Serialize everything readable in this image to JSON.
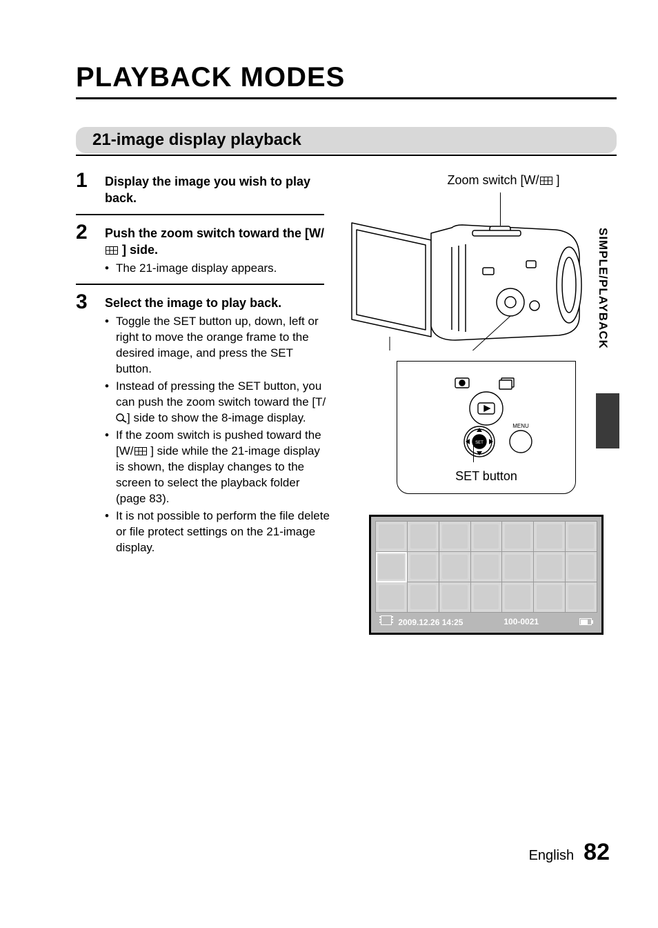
{
  "title": "PLAYBACK MODES",
  "subheading": "21-image display playback",
  "sidebar_label": "SIMPLE/PLAYBACK",
  "zoom_switch_label_pre": "Zoom switch [W/",
  "zoom_switch_label_post": " ]",
  "set_button_label": "SET button",
  "steps": {
    "s1": {
      "num": "1",
      "head": "Display the image you wish to play back."
    },
    "s2": {
      "num": "2",
      "head_pre": "Push the zoom switch toward the [W/",
      "head_post": " ] side.",
      "b1": "The 21-image display appears."
    },
    "s3": {
      "num": "3",
      "head": "Select the image to play back.",
      "b1": "Toggle the SET button up, down, left or right to move the orange frame to the desired image, and press the SET button.",
      "b2_pre": "Instead of pressing the SET button, you can push the zoom switch toward the [T/",
      "b2_post": "] side to show the 8-image display.",
      "b3_pre": "If the zoom switch is pushed toward the [W/",
      "b3_post": " ] side while the 21-image display is shown, the display changes to the screen to select the playback folder (page 83).",
      "b4": "It is not possible to perform the file delete or file protect settings on the 21-image display."
    }
  },
  "screen": {
    "datetime": "2009.12.26  14:25",
    "counter": "100-0021"
  },
  "inset_menu_label": "MENU",
  "footer": {
    "language": "English",
    "page": "82"
  }
}
